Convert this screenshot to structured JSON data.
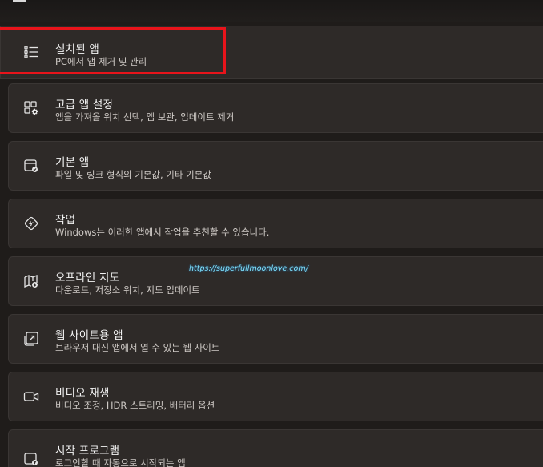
{
  "items": [
    {
      "title": "설치된 앱",
      "subtitle": "PC에서 앱 제거 및 관리",
      "icon": "list-icon"
    },
    {
      "title": "고급 앱 설정",
      "subtitle": "앱을 가져올 위치 선택, 앱 보관, 업데이트 제거",
      "icon": "app-settings-icon"
    },
    {
      "title": "기본 앱",
      "subtitle": "파일 및 링크 형식의 기본값, 기타 기본값",
      "icon": "default-apps-icon"
    },
    {
      "title": "작업",
      "subtitle": "Windows는 이러한 앱에서 작업을 추천할 수 있습니다.",
      "icon": "actions-icon"
    },
    {
      "title": "오프라인 지도",
      "subtitle": "다운로드, 저장소 위치, 지도 업데이트",
      "icon": "offline-map-icon"
    },
    {
      "title": "웹 사이트용 앱",
      "subtitle": "브라우저 대신 앱에서 열 수 있는 웹 사이트",
      "icon": "web-apps-icon"
    },
    {
      "title": "비디오 재생",
      "subtitle": "비디오 조정, HDR 스트리밍, 배터리 옵션",
      "icon": "video-icon"
    },
    {
      "title": "시작 프로그램",
      "subtitle": "로그인할 때 자동으로 시작되는 앱",
      "icon": "startup-icon"
    }
  ],
  "watermark": "https://superfullmoonlove.com/",
  "colors": {
    "highlight": "#e8141b",
    "card": "#2e2a28",
    "background": "#1f1c1a"
  }
}
